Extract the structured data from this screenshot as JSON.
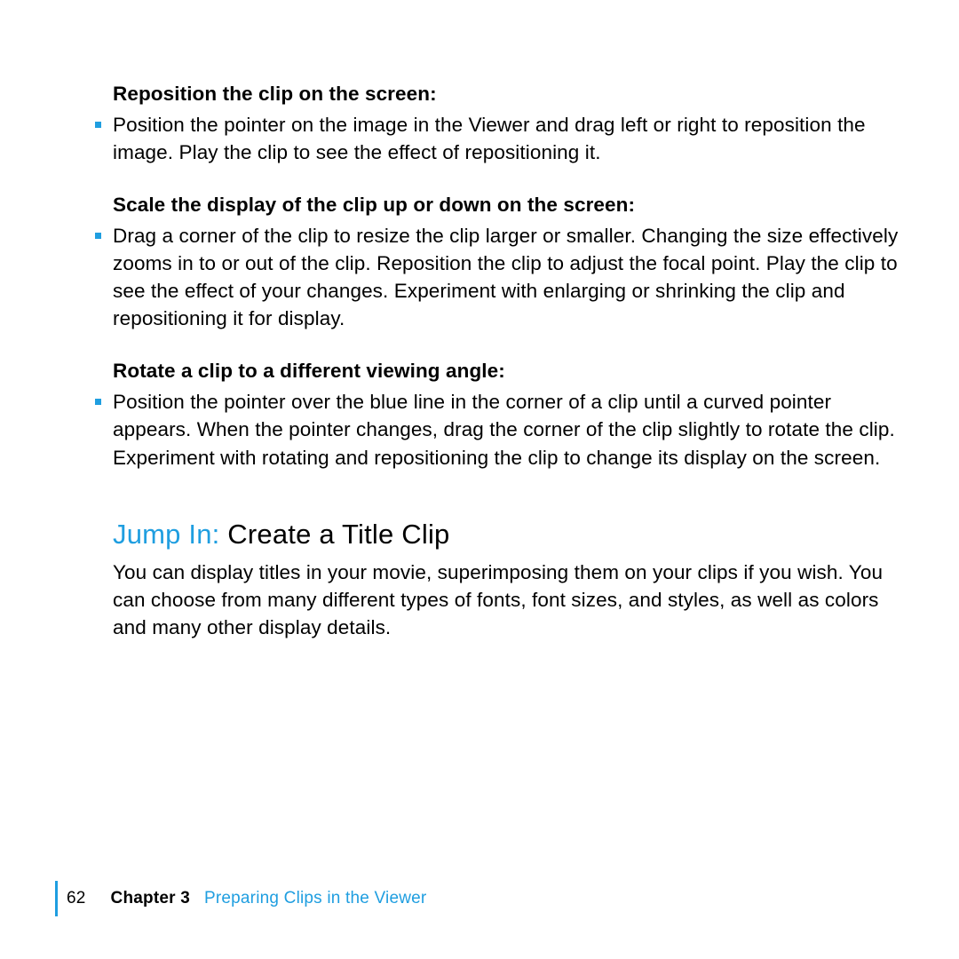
{
  "sections": [
    {
      "heading": "Reposition the clip on the screen:",
      "body": "Position the pointer on the image in the Viewer and drag left or right to reposition the image. Play the clip to see the effect of repositioning it."
    },
    {
      "heading": "Scale the display of the clip up or down on the screen:",
      "body": "Drag a corner of the clip to resize the clip larger or smaller. Changing the size effectively zooms in to or out of the clip. Reposition the clip to adjust the focal point. Play the clip to see the effect of your changes. Experiment with enlarging or shrinking the clip and repositioning it for display."
    },
    {
      "heading": "Rotate a clip to a different viewing angle:",
      "body": "Position the pointer over the blue line in the corner of a clip until a curved pointer appears. When the pointer changes, drag the corner of the clip slightly to rotate the clip. Experiment with rotating and repositioning the clip to change its display on the screen."
    }
  ],
  "title": {
    "prefix": "Jump In:  ",
    "rest": "Create a Title Clip"
  },
  "intro": "You can display titles in your movie, superimposing them on your clips if you wish. You can choose from many different types of fonts, font sizes, and styles, as well as colors and many other display details.",
  "footer": {
    "page": "62",
    "chapter_label": "Chapter 3",
    "chapter_title": "Preparing Clips in the Viewer"
  }
}
